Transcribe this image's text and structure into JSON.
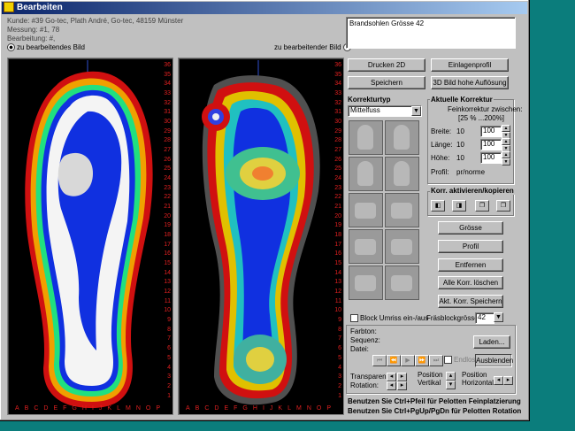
{
  "window": {
    "title": "Bearbeiten"
  },
  "info": {
    "kunde": "Kunde: #39 Go-tec, Plath André, Go-tec, 48159 Münster",
    "messung": "Messung: #1, 78",
    "bearbeitung": "Bearbeitung: #,",
    "radio_left": "zu bearbeitendes Bild",
    "radio_right": "zu bearbeitender Bild"
  },
  "notes": {
    "text": "Brandsohlen Grösse 42"
  },
  "buttons": {
    "drucken": "Drucken 2D",
    "einlagenprofil": "Einlagenprofil",
    "speichern": "Speichern",
    "hohe_aufloesung": "3D Bild hohe Auflösung",
    "grosse": "Grösse",
    "profil": "Profil",
    "entfernen": "Entfernen",
    "alle_loeschen": "Alle Korr. löschen",
    "akt_speichern": "Akt. Korr. Speichern",
    "laden": "Laden...",
    "ausblenden": "Ausblenden"
  },
  "korrektur": {
    "title": "Korrekturtyp",
    "selected": "Mittelfuss",
    "aktuelle_title": "Aktuelle Korrektur",
    "fein_label": "Feinkorrektur zwischen:",
    "fein_range": "[25 % ...200%]",
    "breite_label": "Breite:",
    "breite_val": "10",
    "breite_pct": "100",
    "laenge_label": "Länge:",
    "laenge_val": "10",
    "laenge_pct": "100",
    "hoehe_label": "Höhe:",
    "hoehe_val": "10",
    "hoehe_pct": "100",
    "profil_label": "Profil:",
    "profil_val": "pr/norme",
    "kopieren_title": "Korr. aktivieren/kopieren"
  },
  "block": {
    "label": "Block Umriss ein-/aus",
    "fraesblock_label": "Fräsblockgrösse",
    "fraesblock_val": "42"
  },
  "pelotte": {
    "farbton": "Farbton:",
    "sequenz": "Sequenz:",
    "datei": "Datei:",
    "endlos": "Endlos",
    "transparenz": "Transparenz:",
    "rotation": "Rotation:",
    "position_vertikal": "Position\nVertikal",
    "position_horizontal": "Position\nHorizontal"
  },
  "hints": {
    "line1": "Benutzen Sie Ctrl+Pfeil für Pelotten Feinplatzierung",
    "line2": "Benutzen Sie Ctrl+PgUp/PgDn für Pelotten Rotation"
  },
  "grid": {
    "rows": [
      "36",
      "35",
      "34",
      "33",
      "32",
      "31",
      "30",
      "29",
      "28",
      "27",
      "26",
      "25",
      "24",
      "23",
      "22",
      "21",
      "20",
      "19",
      "18",
      "17",
      "16",
      "15",
      "14",
      "13",
      "12",
      "11",
      "10",
      "9",
      "8",
      "7",
      "6",
      "5",
      "4",
      "3",
      "2",
      "1"
    ],
    "cols": [
      "A",
      "B",
      "C",
      "D",
      "E",
      "F",
      "G",
      "H",
      "I",
      "J",
      "K",
      "L",
      "M",
      "N",
      "O",
      "P"
    ]
  },
  "colors": {
    "accent_red": "#e02020",
    "desktop": "#0b7d7c"
  }
}
